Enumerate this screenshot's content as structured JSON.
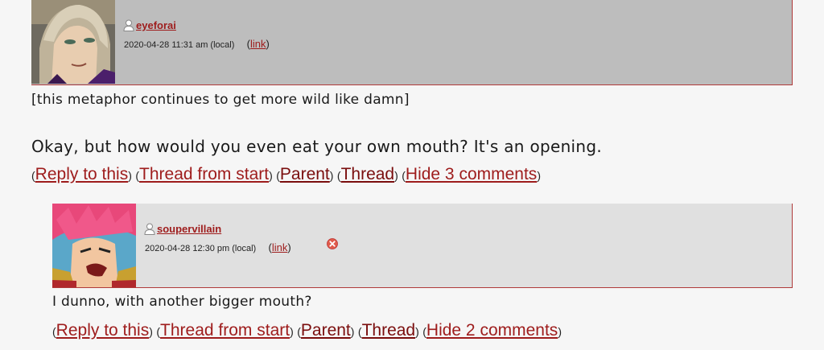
{
  "comments": [
    {
      "username": "eyeforai",
      "timestamp": "2020-04-28 11:31 am (local)",
      "link_label": "link",
      "avatar_icon": "user-icon",
      "body": [
        "[this metaphor continues to get more wild like damn]",
        "Okay, but how would you even eat your own mouth? It's an opening."
      ],
      "actions": {
        "reply": "Reply to this",
        "thread_from_start": "Thread from start",
        "parent": "Parent",
        "thread": "Thread",
        "hide": "Hide 3 comments"
      }
    },
    {
      "username": "soupervillain",
      "timestamp": "2020-04-28 12:30 pm (local)",
      "link_label": "link",
      "avatar_icon": "user-icon",
      "delete_icon": "delete-icon",
      "body": [
        "I dunno, with another bigger mouth?"
      ],
      "actions": {
        "reply": "Reply to this",
        "thread_from_start": "Thread from start",
        "parent": "Parent",
        "thread": "Thread",
        "hide": "Hide 2 comments"
      }
    }
  ],
  "colors": {
    "header_bg_1": "#bdbdbd",
    "header_bg_2": "#e0e0e0",
    "link": "#9e1c1c",
    "border": "#b03a3a"
  }
}
